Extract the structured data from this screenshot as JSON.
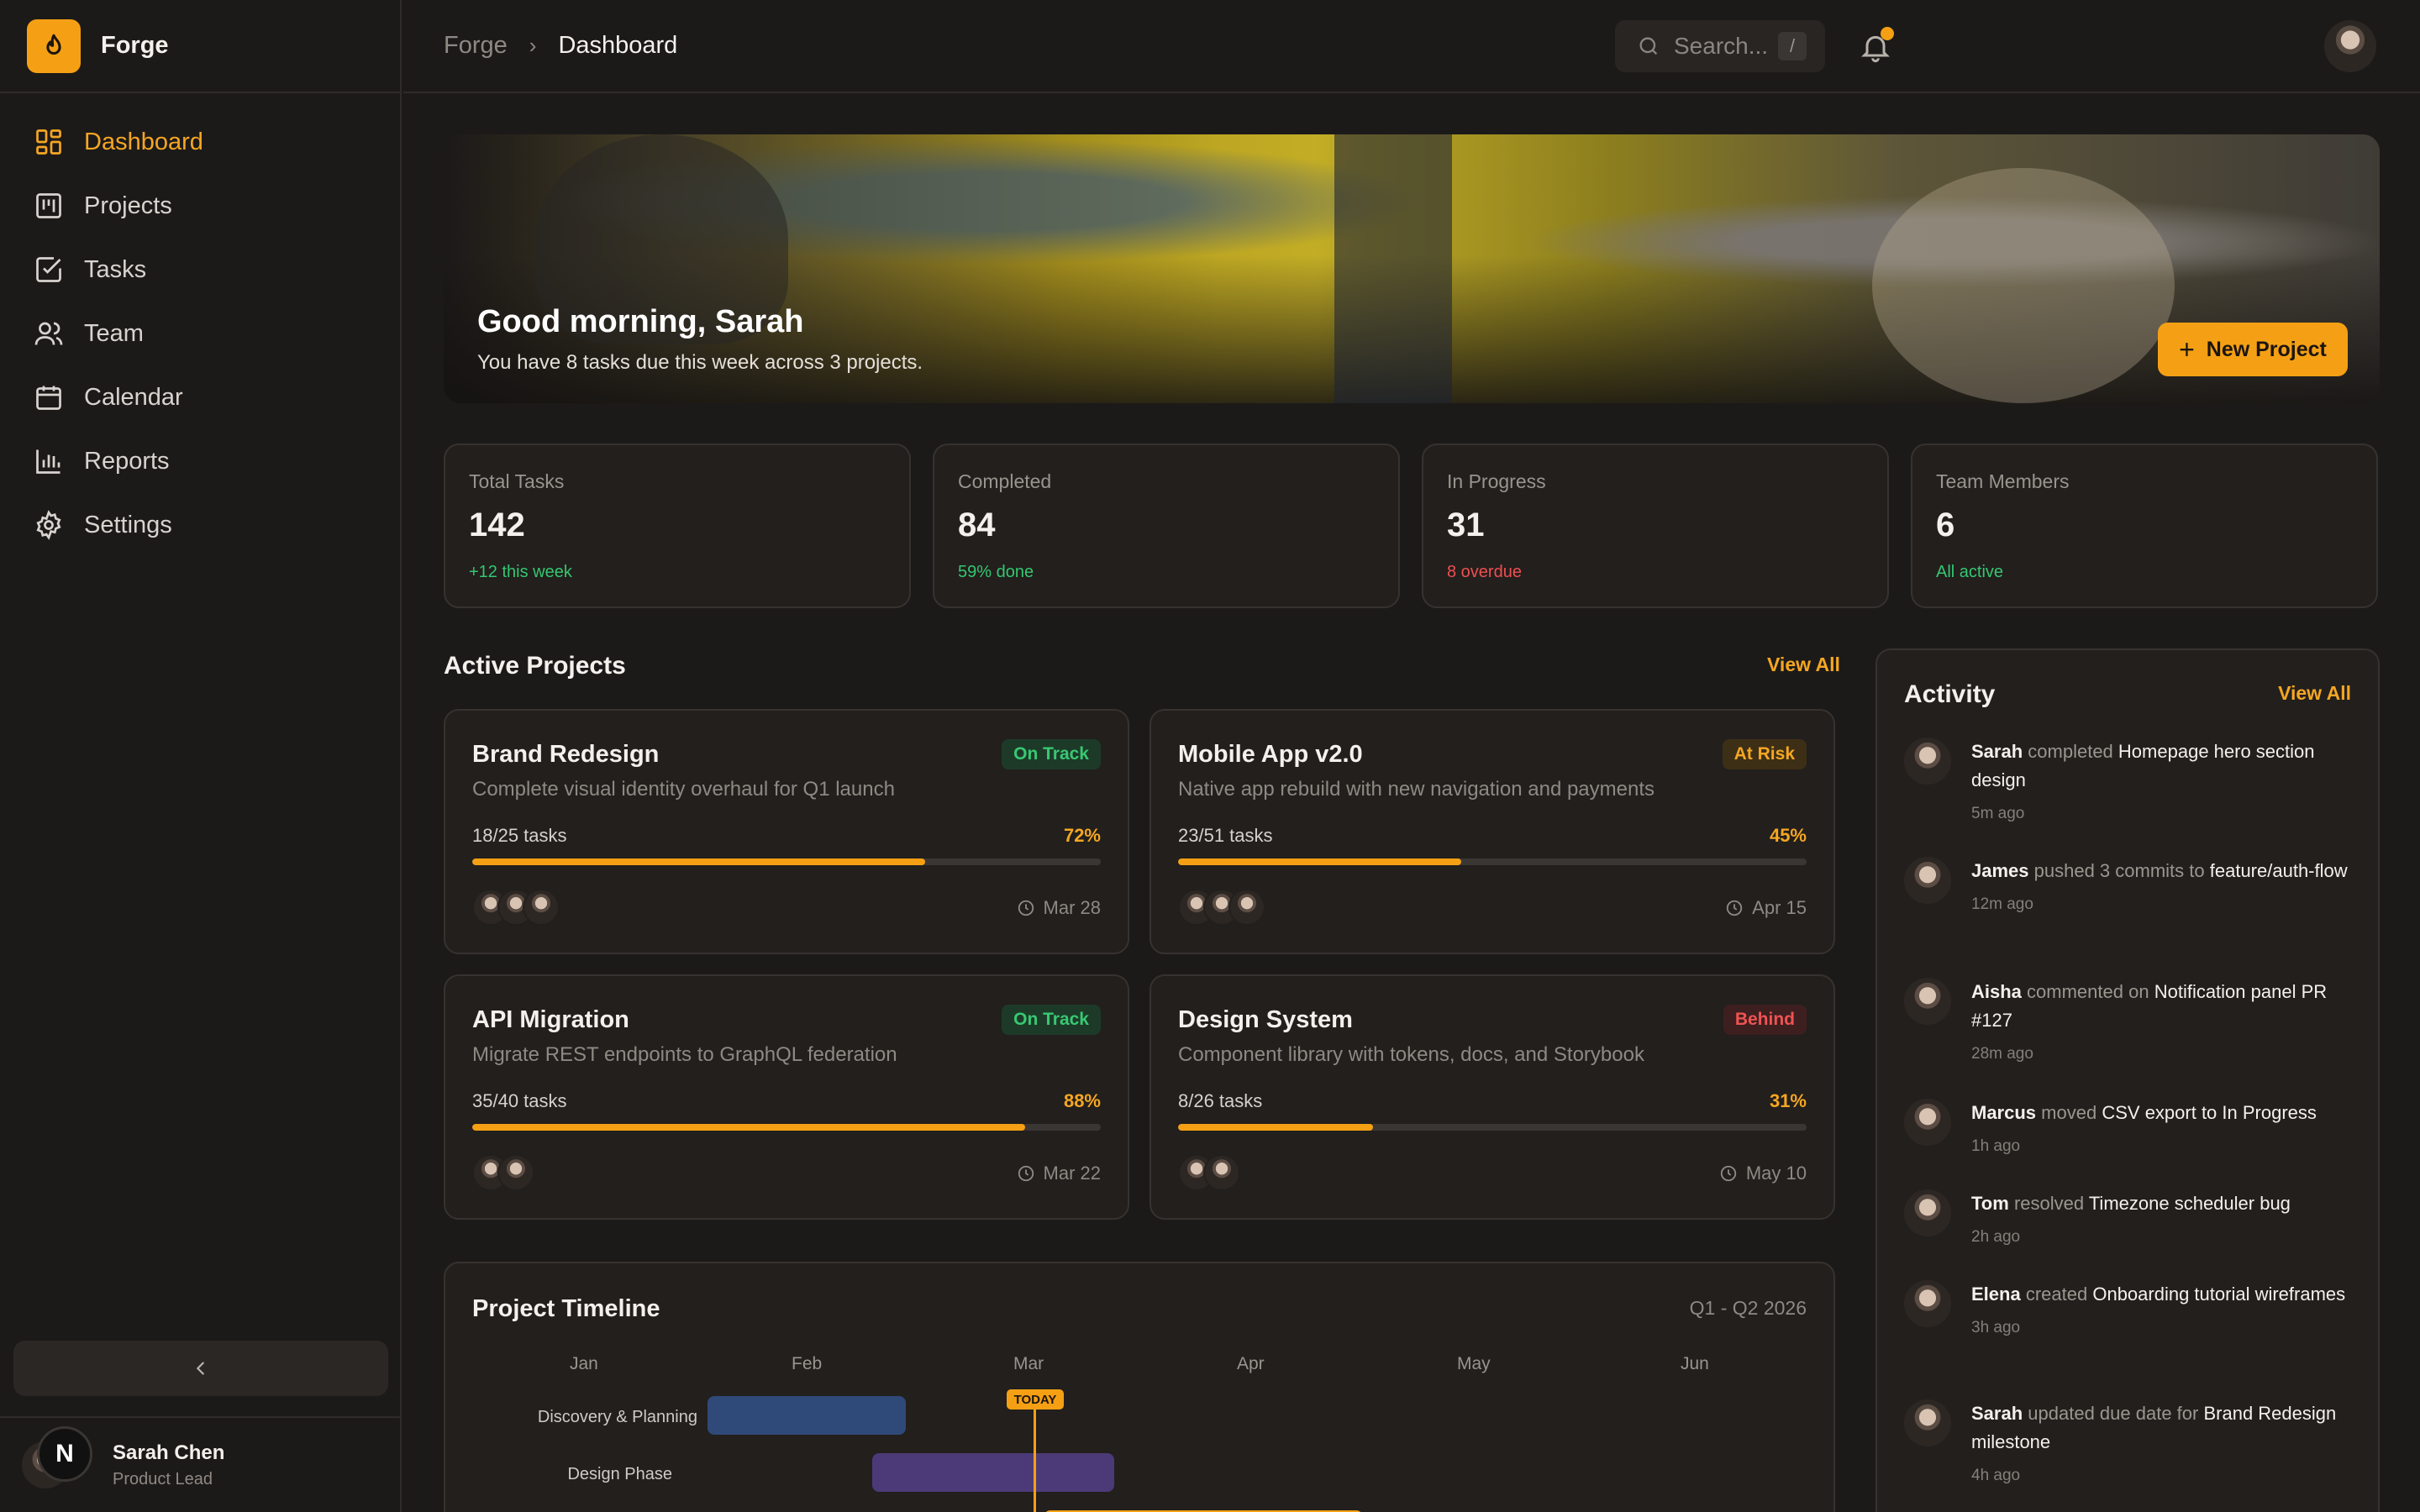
{
  "brand": {
    "name": "Forge"
  },
  "nav": {
    "items": [
      {
        "label": "Dashboard",
        "icon": "dashboard-icon"
      },
      {
        "label": "Projects",
        "icon": "projects-icon"
      },
      {
        "label": "Tasks",
        "icon": "tasks-icon"
      },
      {
        "label": "Team",
        "icon": "team-icon"
      },
      {
        "label": "Calendar",
        "icon": "calendar-icon"
      },
      {
        "label": "Reports",
        "icon": "reports-icon"
      },
      {
        "label": "Settings",
        "icon": "settings-icon"
      }
    ]
  },
  "user": {
    "name": "Sarah Chen",
    "role": "Product Lead",
    "badge": "N"
  },
  "breadcrumb": {
    "root": "Forge",
    "current": "Dashboard"
  },
  "search": {
    "placeholder": "Search...",
    "shortcut": "/"
  },
  "hero": {
    "title": "Good morning, Sarah",
    "subtitle": "You have 8 tasks due this week across 3 projects.",
    "button": "New Project"
  },
  "stats": [
    {
      "label": "Total Tasks",
      "value": "142",
      "note": "+12 this week"
    },
    {
      "label": "Completed",
      "value": "84",
      "note": "59% done"
    },
    {
      "label": "In Progress",
      "value": "31",
      "note": "8 overdue"
    },
    {
      "label": "Team Members",
      "value": "6",
      "note": "All active"
    }
  ],
  "projects_section": {
    "title": "Active Projects",
    "view_all": "View All"
  },
  "projects": [
    {
      "title": "Brand Redesign",
      "status": "On Track",
      "description": "Complete visual identity overhaul for Q1 launch",
      "tasks": "18/25 tasks",
      "percent": "72%",
      "progress": 0.72,
      "due": "Mar 28"
    },
    {
      "title": "Mobile App v2.0",
      "status": "At Risk",
      "description": "Native app rebuild with new navigation and payments",
      "tasks": "23/51 tasks",
      "percent": "45%",
      "progress": 0.45,
      "due": "Apr 15"
    },
    {
      "title": "API Migration",
      "status": "On Track",
      "description": "Migrate REST endpoints to GraphQL federation",
      "tasks": "35/40 tasks",
      "percent": "88%",
      "progress": 0.88,
      "due": "Mar 22"
    },
    {
      "title": "Design System",
      "status": "Behind",
      "description": "Component library with tokens, docs, and Storybook",
      "tasks": "8/26 tasks",
      "percent": "31%",
      "progress": 0.31,
      "due": "May 10"
    }
  ],
  "timeline": {
    "title": "Project Timeline",
    "range": "Q1 - Q2 2026",
    "months": [
      "Jan",
      "Feb",
      "Mar",
      "Apr",
      "May",
      "Jun"
    ],
    "today_label": "TODAY",
    "rows": [
      {
        "label": "Discovery & Planning",
        "color": "#2f4a78"
      },
      {
        "label": "Design Phase",
        "color": "#4c3a78"
      }
    ]
  },
  "activity": {
    "title": "Activity",
    "view_all": "View All",
    "items": [
      {
        "actor": "Sarah",
        "action": "completed",
        "object": "Homepage hero section design",
        "time": "5m ago"
      },
      {
        "actor": "James",
        "action": "pushed 3 commits to",
        "object": "feature/auth-flow",
        "time": "12m ago"
      },
      {
        "actor": "Aisha",
        "action": "commented on",
        "object": "Notification panel PR #127",
        "time": "28m ago"
      },
      {
        "actor": "Marcus",
        "action": "moved",
        "object": "CSV export to In Progress",
        "time": "1h ago"
      },
      {
        "actor": "Tom",
        "action": "resolved",
        "object": "Timezone scheduler bug",
        "time": "2h ago"
      },
      {
        "actor": "Elena",
        "action": "created",
        "object": "Onboarding tutorial wireframes",
        "time": "3h ago"
      },
      {
        "actor": "Sarah",
        "action": "updated due date for",
        "object": "Brand Redesign milestone",
        "time": "4h ago"
      }
    ]
  },
  "colors": {
    "accent": "#f5a014",
    "success": "#34c770",
    "danger": "#ef4f4f",
    "background": "#1c1a19"
  }
}
